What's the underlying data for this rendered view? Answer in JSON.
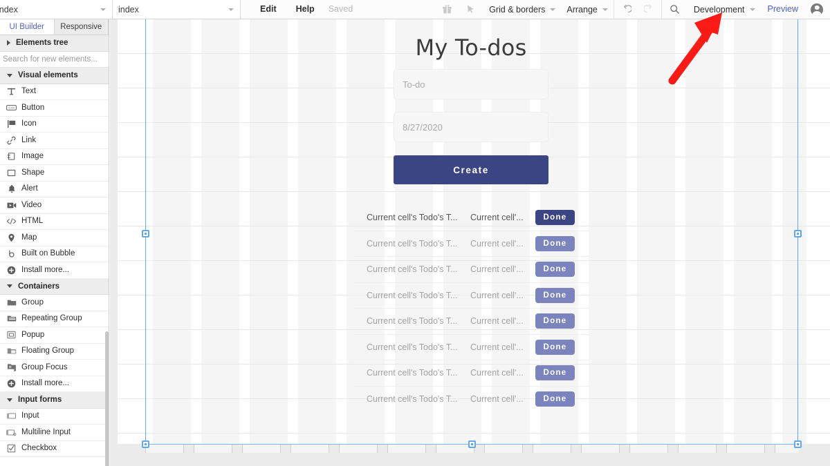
{
  "topbar": {
    "app_select": "index",
    "page_select": "index",
    "menus": [
      "Edit",
      "Help"
    ],
    "save_status": "Saved",
    "gift_icon": "gift-icon",
    "cursor_icon": "cursor-icon",
    "grid_borders": "Grid & borders",
    "arrange": "Arrange",
    "undo_icon": "undo-icon",
    "redo_icon": "redo-icon",
    "search_icon": "search-icon",
    "version": "Development",
    "preview": "Preview",
    "avatar": "user-avatar"
  },
  "leftpanel": {
    "tabs": [
      {
        "label": "UI Builder",
        "active": true
      },
      {
        "label": "Responsive",
        "active": false
      }
    ],
    "elements_tree": "Elements tree",
    "search_placeholder": "Search for new elements...",
    "search_value": "",
    "groups": [
      {
        "title": "Visual elements",
        "items": [
          {
            "label": "Text",
            "icon": "text-icon"
          },
          {
            "label": "Button",
            "icon": "button-icon"
          },
          {
            "label": "Icon",
            "icon": "flag-icon"
          },
          {
            "label": "Link",
            "icon": "link-icon"
          },
          {
            "label": "Image",
            "icon": "image-icon"
          },
          {
            "label": "Shape",
            "icon": "shape-icon"
          },
          {
            "label": "Alert",
            "icon": "bell-icon"
          },
          {
            "label": "Video",
            "icon": "video-icon"
          },
          {
            "label": "HTML",
            "icon": "code-icon"
          },
          {
            "label": "Map",
            "icon": "map-pin-icon"
          },
          {
            "label": "Built on Bubble",
            "icon": "bubble-icon"
          },
          {
            "label": "Install more...",
            "icon": "plus-circle-icon"
          }
        ]
      },
      {
        "title": "Containers",
        "items": [
          {
            "label": "Group",
            "icon": "folder-icon"
          },
          {
            "label": "Repeating Group",
            "icon": "repeating-group-icon"
          },
          {
            "label": "Popup",
            "icon": "popup-icon"
          },
          {
            "label": "Floating Group",
            "icon": "floating-group-icon"
          },
          {
            "label": "Group Focus",
            "icon": "group-focus-icon"
          },
          {
            "label": "Install more...",
            "icon": "plus-circle-icon"
          }
        ]
      },
      {
        "title": "Input forms",
        "items": [
          {
            "label": "Input",
            "icon": "input-icon"
          },
          {
            "label": "Multiline Input",
            "icon": "multiline-input-icon"
          },
          {
            "label": "Checkbox",
            "icon": "checkbox-icon"
          }
        ]
      }
    ]
  },
  "canvas": {
    "page_title": "My To-dos",
    "todo_input_placeholder": "To-do",
    "date_input_placeholder": "8/27/2020",
    "create_button": "Create",
    "rows": [
      {
        "col1": "Current cell's Todo's T...",
        "col2": "Current cell'...",
        "button": "Done",
        "first": true
      },
      {
        "col1": "Current cell's Todo's T...",
        "col2": "Current cell'...",
        "button": "Done",
        "first": false
      },
      {
        "col1": "Current cell's Todo's T...",
        "col2": "Current cell'...",
        "button": "Done",
        "first": false
      },
      {
        "col1": "Current cell's Todo's T...",
        "col2": "Current cell'...",
        "button": "Done",
        "first": false
      },
      {
        "col1": "Current cell's Todo's T...",
        "col2": "Current cell'...",
        "button": "Done",
        "first": false
      },
      {
        "col1": "Current cell's Todo's T...",
        "col2": "Current cell'...",
        "button": "Done",
        "first": false
      },
      {
        "col1": "Current cell's Todo's T...",
        "col2": "Current cell'...",
        "button": "Done",
        "first": false
      },
      {
        "col1": "Current cell's Todo's T...",
        "col2": "Current cell'...",
        "button": "Done",
        "first": false
      }
    ]
  },
  "annotation": {
    "arrow": "red-arrow-pointing-to-development"
  },
  "colors": {
    "accent_blue": "#5661c9",
    "button_navy": "#3b4583",
    "button_light": "#7b84bd",
    "selection_blue": "#62a8ee",
    "arrow_red": "#fc1a16"
  }
}
